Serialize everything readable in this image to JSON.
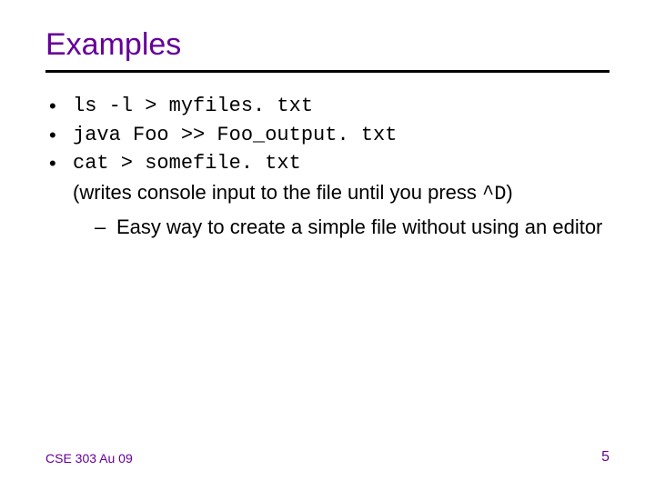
{
  "title": "Examples",
  "bullets": {
    "b1": "ls -l > myfiles. txt",
    "b2": "java Foo >> Foo_output. txt",
    "b3": "cat > somefile. txt",
    "b3_note_pre": "(writes console input to the file until you press ",
    "b3_note_code": "^D",
    "b3_note_post": ")",
    "sub1": "Easy way to create a simple file without using an editor"
  },
  "footer": {
    "left": "CSE 303 Au 09",
    "right": "5"
  }
}
